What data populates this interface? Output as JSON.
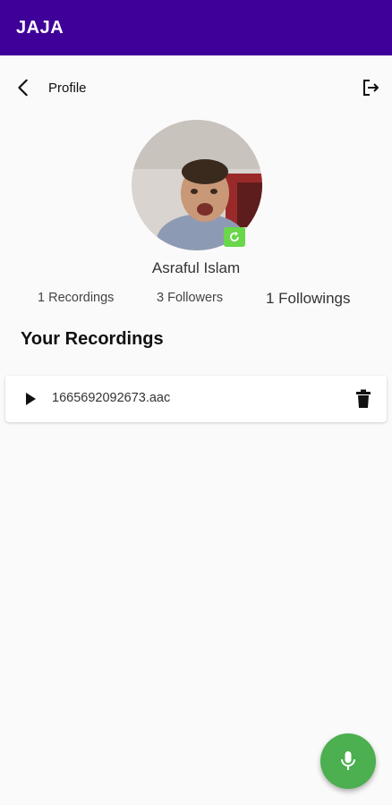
{
  "app": {
    "title": "JAJA"
  },
  "header": {
    "title": "Profile",
    "back_icon": "arrow-back-icon",
    "logout_icon": "logout-icon"
  },
  "profile": {
    "name": "Asraful Islam",
    "stats": {
      "recordings": "1 Recordings",
      "followers": "3 Followers",
      "followings": "1 Followings"
    }
  },
  "recordings": {
    "title": "Your Recordings",
    "items": [
      {
        "file": "1665692092673.aac"
      }
    ]
  },
  "fab": {
    "icon": "mic-icon"
  },
  "colors": {
    "appbar": "#3f0099",
    "fab": "#4caf50",
    "edit_badge": "#6ad64a"
  }
}
